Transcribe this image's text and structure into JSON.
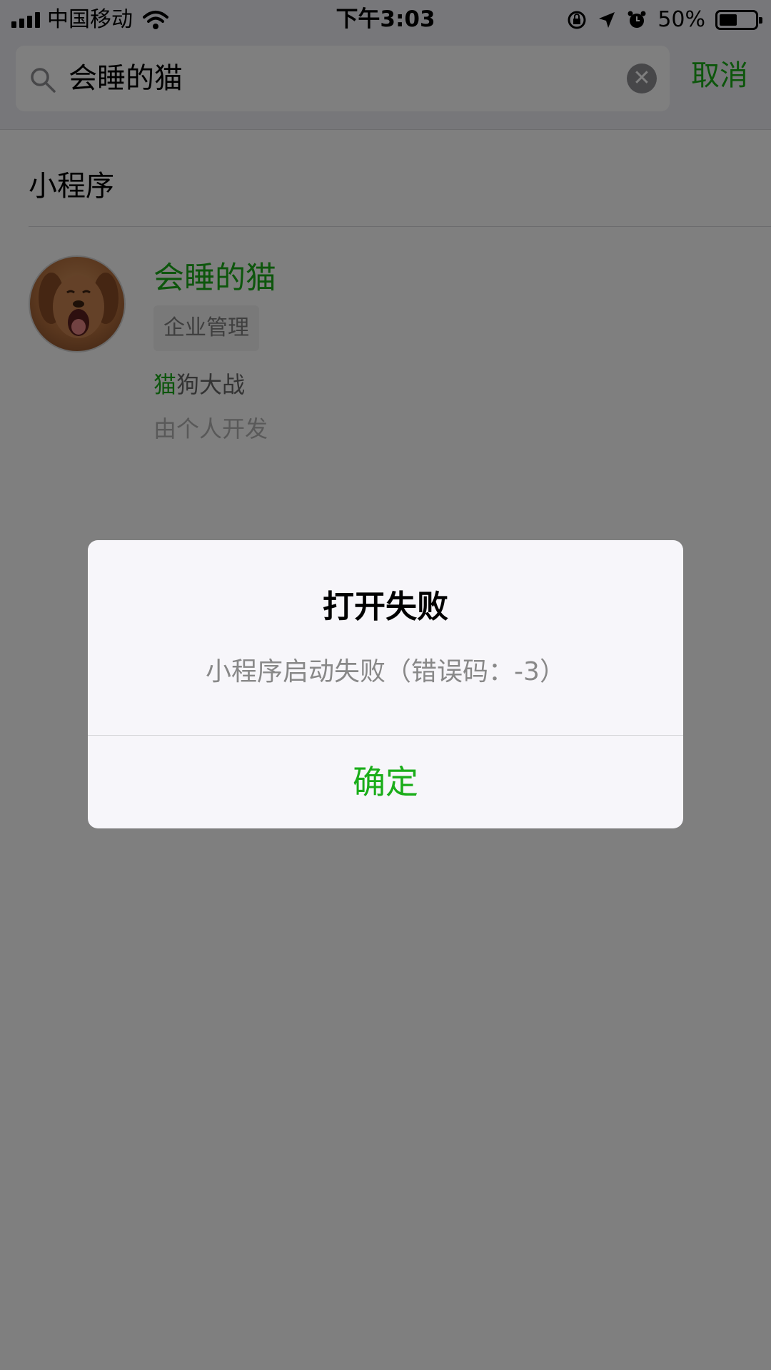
{
  "status_bar": {
    "carrier": "中国移动",
    "time": "下午3:03",
    "battery_percent": "50%",
    "battery_level": 0.5,
    "icons": [
      "signal-icon",
      "wifi-icon",
      "orientation-lock-icon",
      "location-icon",
      "alarm-icon",
      "battery-icon"
    ]
  },
  "search": {
    "query": "会睡的猫",
    "cancel_label": "取消",
    "icons": [
      "search-icon",
      "clear-icon"
    ]
  },
  "results": {
    "section_title": "小程序",
    "items": [
      {
        "name": "会睡的猫",
        "tag": "企业管理",
        "description_highlight": "猫",
        "description_rest": "狗大战",
        "developer": "由个人开发",
        "avatar": "dog-avatar"
      }
    ]
  },
  "dialog": {
    "title": "打开失败",
    "message": "小程序启动失败（错误码：-3）",
    "confirm_label": "确定"
  },
  "colors": {
    "accent": "#1aad19",
    "overlay": "rgba(0,0,0,0.5)",
    "header_bg": "#efeff4"
  }
}
